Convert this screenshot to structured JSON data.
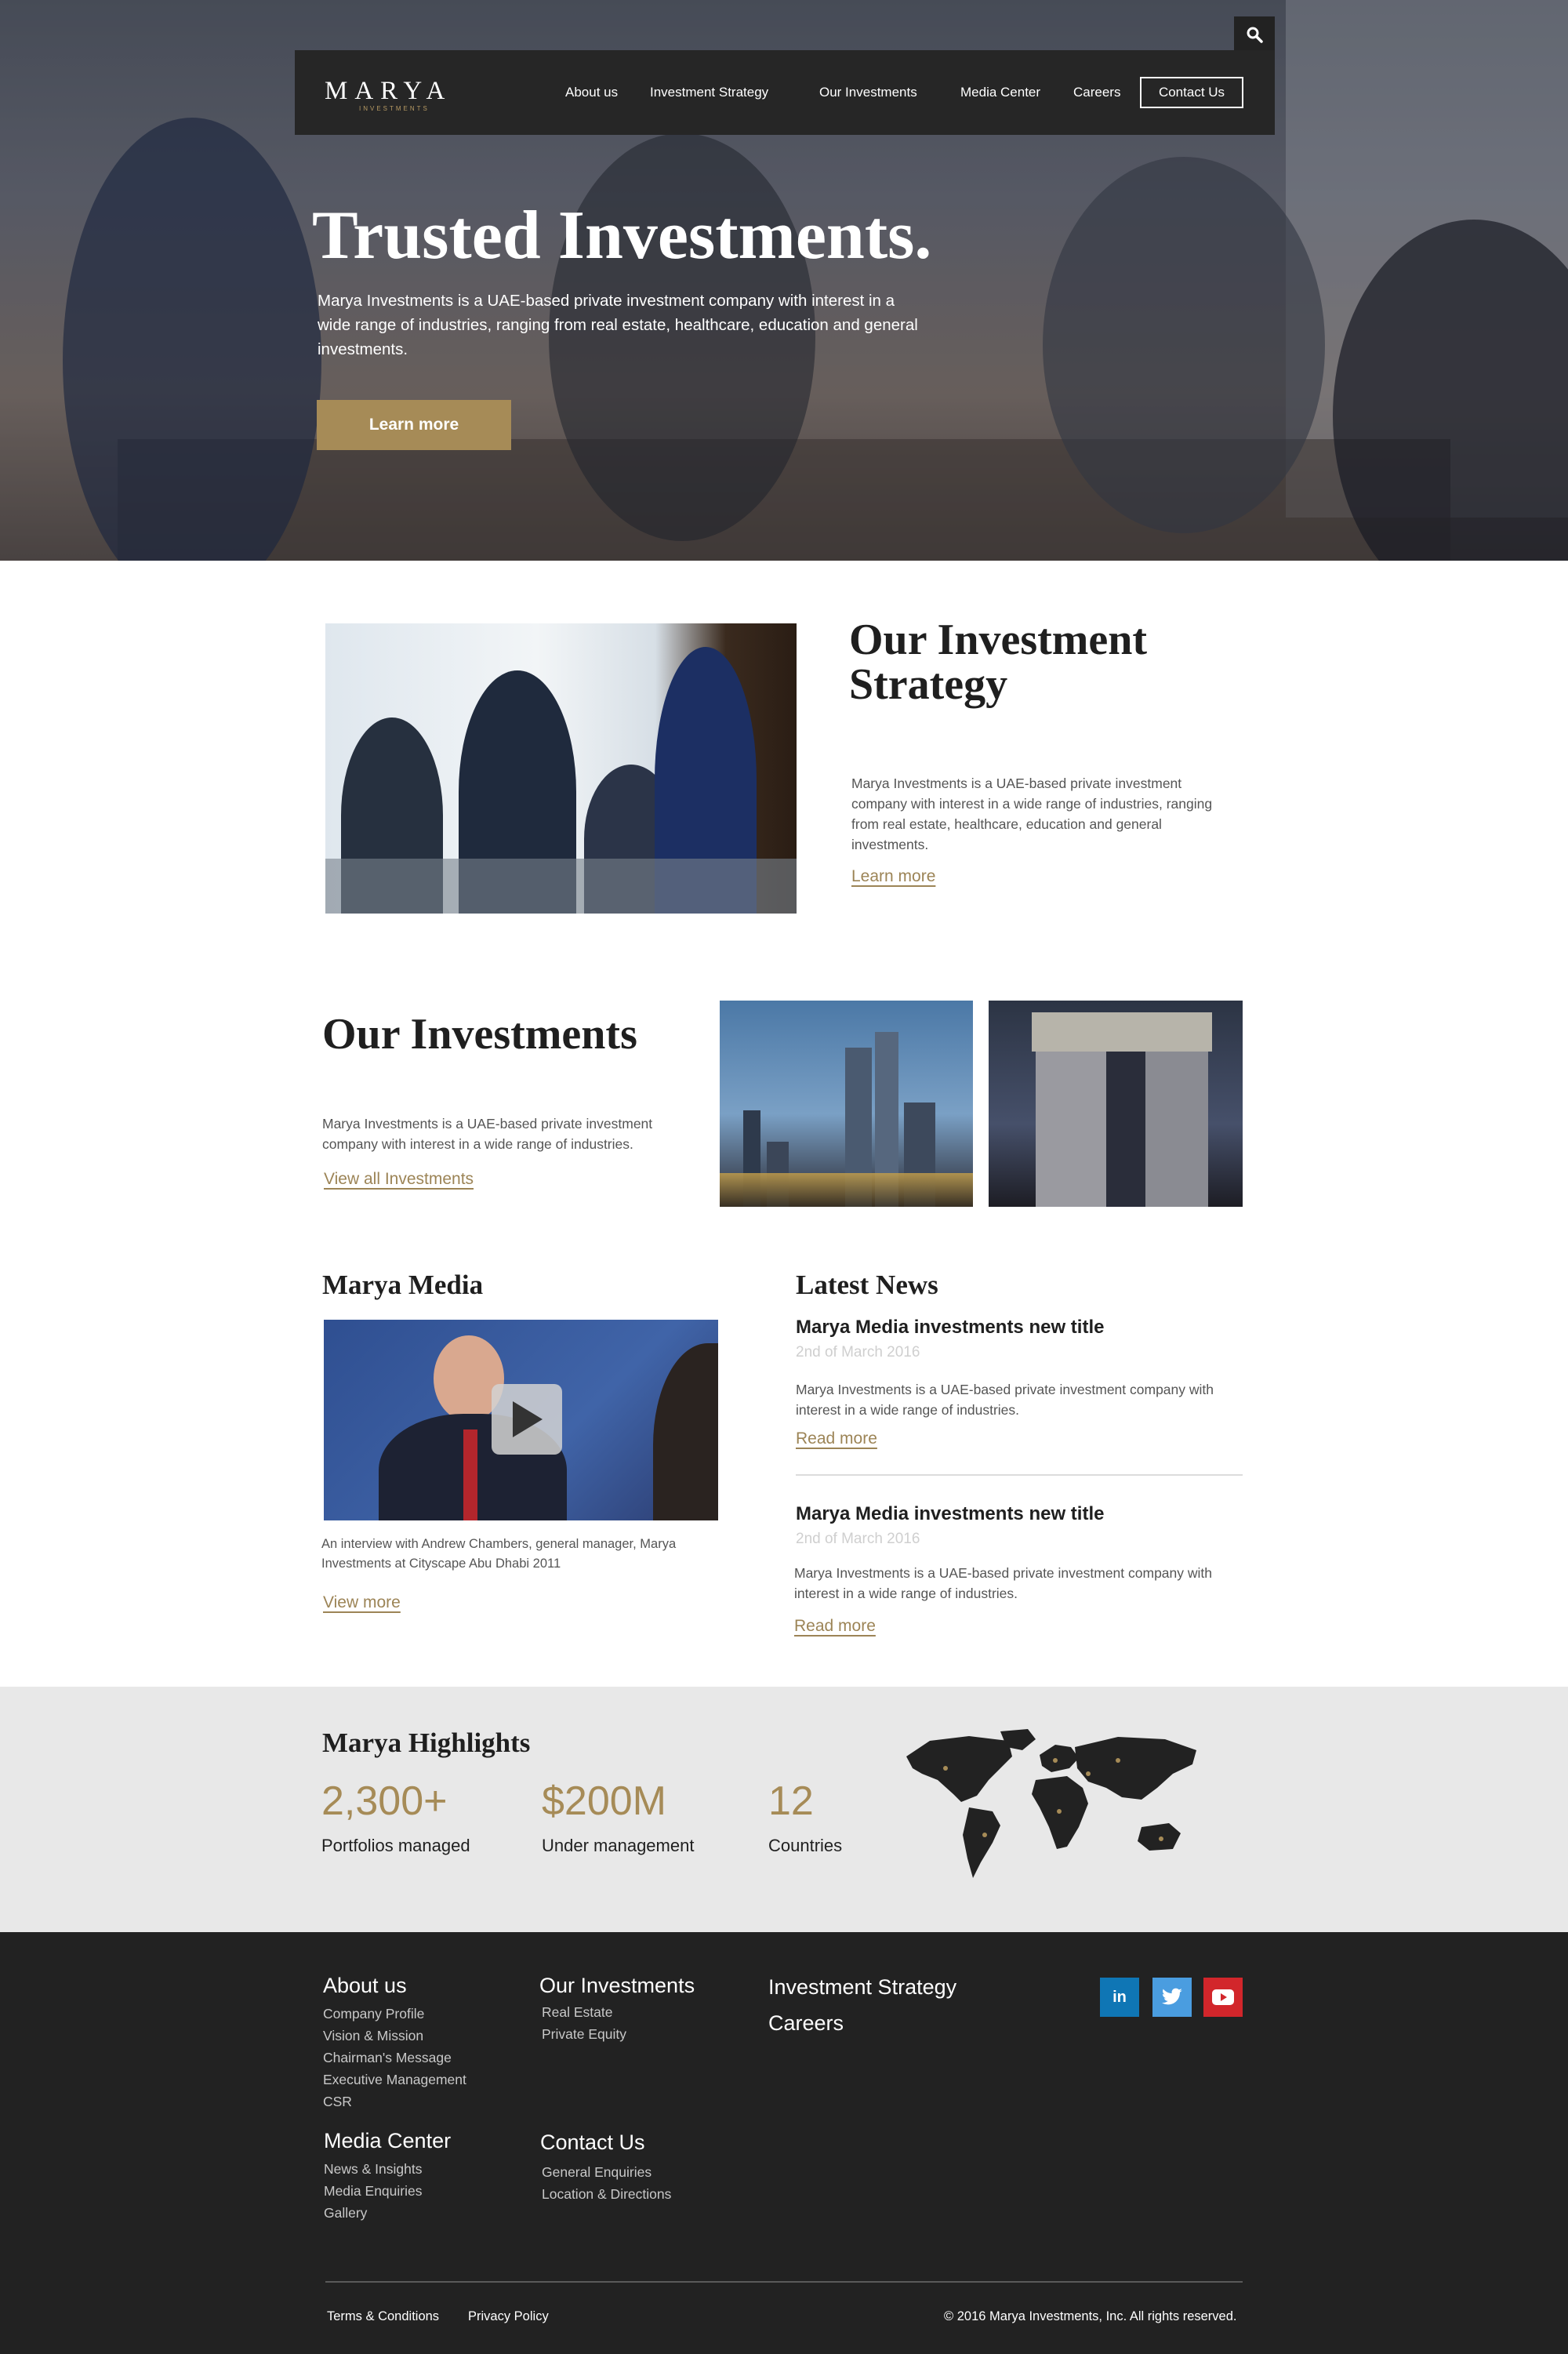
{
  "nav": {
    "logo_text": "MARYA",
    "logo_subtext": "INVESTMENTS",
    "items": [
      "About us",
      "Investment Strategy",
      "Our Investments",
      "Media Center",
      "Careers"
    ],
    "contact_label": "Contact Us",
    "search_icon": "search-icon"
  },
  "hero": {
    "title": "Trusted Investments.",
    "description": "Marya Investments is a UAE-based private investment company with interest in a wide range of industries, ranging from real estate, healthcare, education and general investments.",
    "button_label": "Learn more"
  },
  "strategy": {
    "title": "Our Investment Strategy",
    "description": "Marya Investments is a UAE-based private investment company with interest in a wide range of industries, ranging from real estate, healthcare, education and general investments.",
    "link_label": "Learn more"
  },
  "investments": {
    "title": "Our Investments",
    "description": "Marya Investments is a UAE-based private investment company with interest in a wide range of industries.",
    "link_label": "View all Investments"
  },
  "media": {
    "title": "Marya Media",
    "caption": "An interview with Andrew Chambers, general manager, Marya Investments at Cityscape Abu Dhabi 2011",
    "link_label": "View more"
  },
  "news": {
    "title": "Latest News",
    "items": [
      {
        "headline": "Marya Media investments new title",
        "date": "2nd of March 2016",
        "description": "Marya Investments is a UAE-based private investment company with interest in a wide range of industries.",
        "link_label": "Read more"
      },
      {
        "headline": "Marya Media investments new title",
        "date": "2nd of March 2016",
        "description": "Marya Investments is a UAE-based private investment company with interest in a wide range of industries.",
        "link_label": "Read more"
      }
    ]
  },
  "highlights": {
    "title": "Marya Highlights",
    "stats": [
      {
        "value": "2,300+",
        "label": "Portfolios managed"
      },
      {
        "value": "$200M",
        "label": "Under management"
      },
      {
        "value": "12",
        "label": "Countries"
      }
    ],
    "accent_color": "#a68b57"
  },
  "footer": {
    "about": {
      "title": "About us",
      "links": [
        "Company Profile",
        "Vision & Mission",
        "Chairman's Message",
        "Executive Management",
        "CSR"
      ]
    },
    "investments": {
      "title": "Our Investments",
      "links": [
        "Real Estate",
        "Private Equity"
      ]
    },
    "strategy_title": "Investment Strategy",
    "careers_title": "Careers",
    "media": {
      "title": "Media Center",
      "links": [
        "News & Insights",
        "Media Enquiries",
        "Gallery"
      ]
    },
    "contact": {
      "title": "Contact Us",
      "links": [
        "General Enquiries",
        "Location & Directions"
      ]
    },
    "social": {
      "linkedin": {
        "label": "in",
        "color": "#0f76b5"
      },
      "twitter": {
        "color": "#4a9de0"
      },
      "youtube": {
        "color": "#d2262b"
      }
    },
    "terms_label": "Terms & Conditions",
    "privacy_label": "Privacy Policy",
    "copyright": "© 2016 Marya Investments, Inc. All rights reserved."
  }
}
